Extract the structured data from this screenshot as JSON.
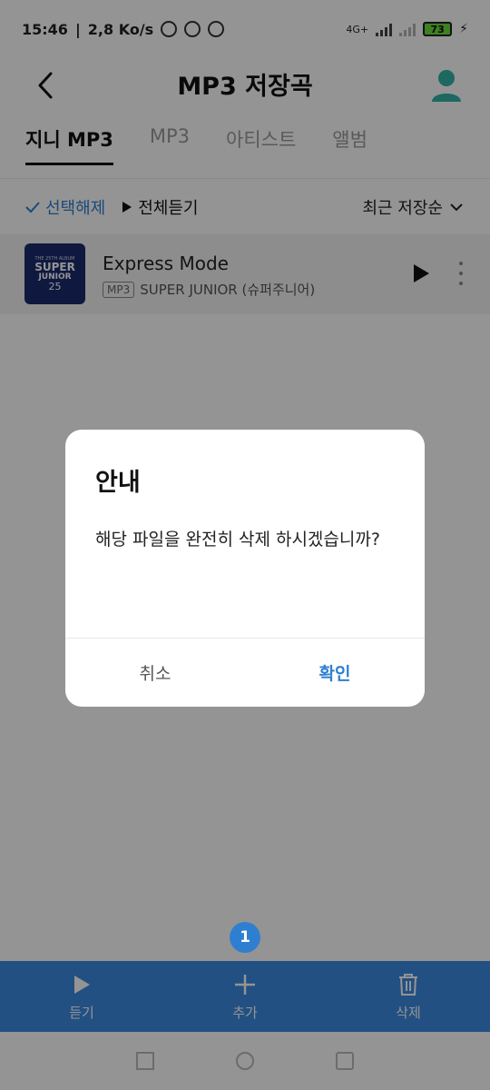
{
  "status_bar": {
    "time": "15:46",
    "speed": "2,8 Ko/s",
    "network": "4G+",
    "battery": "73"
  },
  "header": {
    "title": "MP3 저장곡"
  },
  "tabs": [
    {
      "label": "지니 MP3"
    },
    {
      "label": "MP3"
    },
    {
      "label": "아티스트"
    },
    {
      "label": "앨범"
    }
  ],
  "toolbar": {
    "deselect_label": "선택해제",
    "play_all_label": "전체듣기",
    "sort_label": "최근 저장순"
  },
  "song": {
    "title": "Express Mode",
    "badge": "MP3",
    "artist": "SUPER JUNIOR (슈퍼주니어)",
    "art": {
      "line1": "THE 25TH ALBUM",
      "line2": "SUPER",
      "line3": "JUNIOR",
      "line4": "25"
    }
  },
  "bottom_bar": {
    "selected_count": "1",
    "items": [
      {
        "label": "듣기",
        "icon": "play-icon"
      },
      {
        "label": "추가",
        "icon": "plus-icon"
      },
      {
        "label": "삭제",
        "icon": "trash-icon"
      }
    ]
  },
  "dialog": {
    "title": "안내",
    "message": "해당 파일을 완전히 삭제 하시겠습니까?",
    "cancel_label": "취소",
    "confirm_label": "확인"
  },
  "colors": {
    "accent": "#2f7fd1",
    "bottom_bar": "#3b8be0",
    "overlay": "rgba(0,0,0,0.42)"
  }
}
